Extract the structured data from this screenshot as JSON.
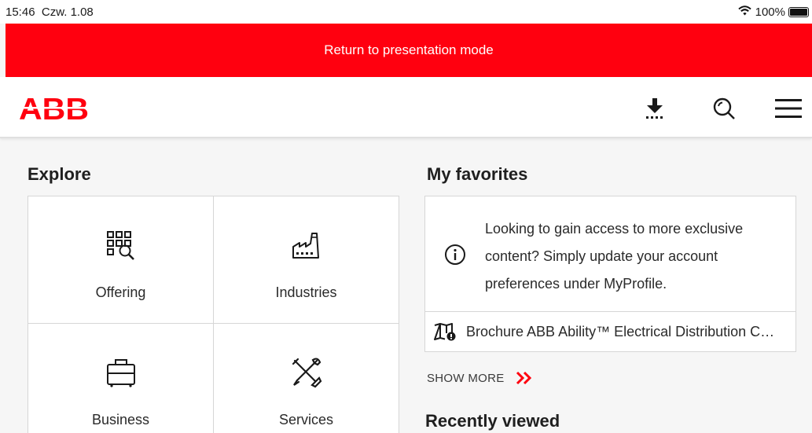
{
  "status_bar": {
    "time": "15:46",
    "date": "Czw. 1.08",
    "battery": "100%"
  },
  "banner": {
    "label": "Return to presentation mode",
    "color": "#ff000f"
  },
  "header": {
    "logo_text": "ABB",
    "icons": [
      "download-icon",
      "search-icon",
      "menu-icon"
    ]
  },
  "explore": {
    "title": "Explore",
    "tiles": [
      {
        "label": "Offering",
        "icon": "offering-grid-search-icon"
      },
      {
        "label": "Industries",
        "icon": "factory-icon"
      },
      {
        "label": "Business",
        "icon": "briefcase-icon"
      },
      {
        "label": "Services",
        "icon": "tools-icon"
      }
    ]
  },
  "favorites": {
    "title": "My favorites",
    "info_text": "Looking to gain access to more exclusive content? Simply update your account preferences under MyProfile.",
    "items": [
      {
        "label": "Brochure ABB Ability™ Electrical Distribution Control System",
        "icon": "map-icon"
      }
    ],
    "show_more": "SHOW MORE"
  },
  "recently_viewed": {
    "title": "Recently viewed"
  }
}
